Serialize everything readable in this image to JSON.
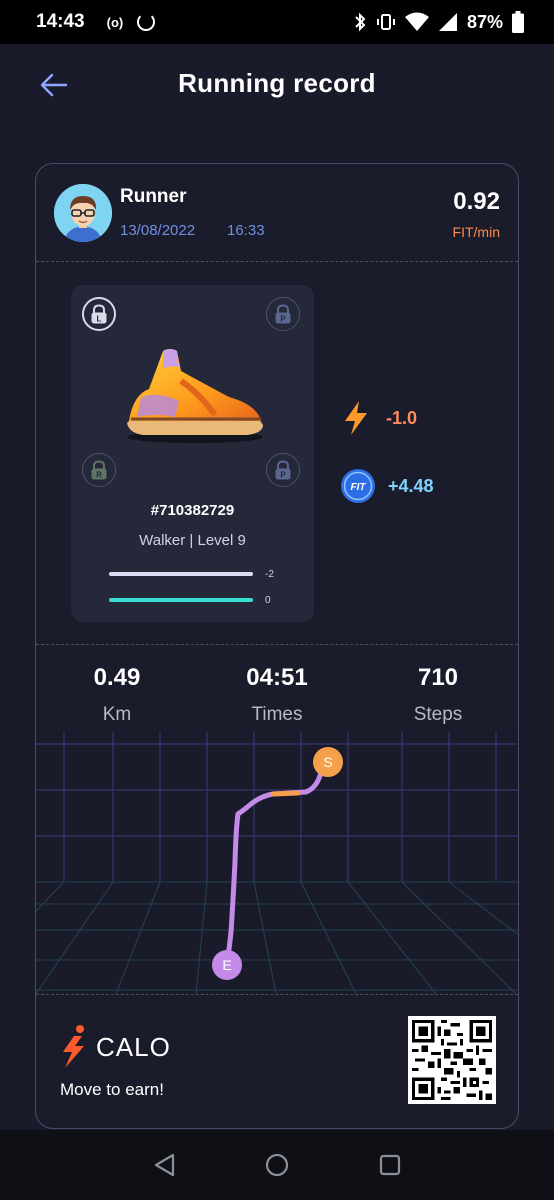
{
  "status_bar": {
    "time": "14:43",
    "radio": "(o)",
    "battery": "87%"
  },
  "header": {
    "title": "Running record",
    "back_icon": "arrow-left-icon"
  },
  "runner": {
    "name": "Runner",
    "date": "13/08/2022",
    "time": "16:33",
    "rate_value": "0.92",
    "rate_unit": "FIT/min"
  },
  "shoe": {
    "id": "#710382729",
    "level_text": "Walker | Level 9",
    "locks": [
      "L",
      "P",
      "R",
      "P"
    ],
    "bar1_value": "-2",
    "bar2_value": "0",
    "bar1_color": "#d9dcf2",
    "bar2_color": "#38e0d2"
  },
  "earnings": {
    "energy": "-1.0",
    "fit": "+4.48",
    "fit_badge": "FIT"
  },
  "stats": [
    {
      "value": "0.49",
      "label": "Km"
    },
    {
      "value": "04:51",
      "label": "Times"
    },
    {
      "value": "710",
      "label": "Steps"
    }
  ],
  "map": {
    "start_label": "S",
    "end_label": "E",
    "route_color": "#c48ae8",
    "start_color": "#f5a04a"
  },
  "footer": {
    "brand": "CALO",
    "slogan": "Move to earn!"
  },
  "colors": {
    "background": "#1a1b2a",
    "accent_orange": "#ff8a4c",
    "accent_blue": "#6f8fe0"
  }
}
